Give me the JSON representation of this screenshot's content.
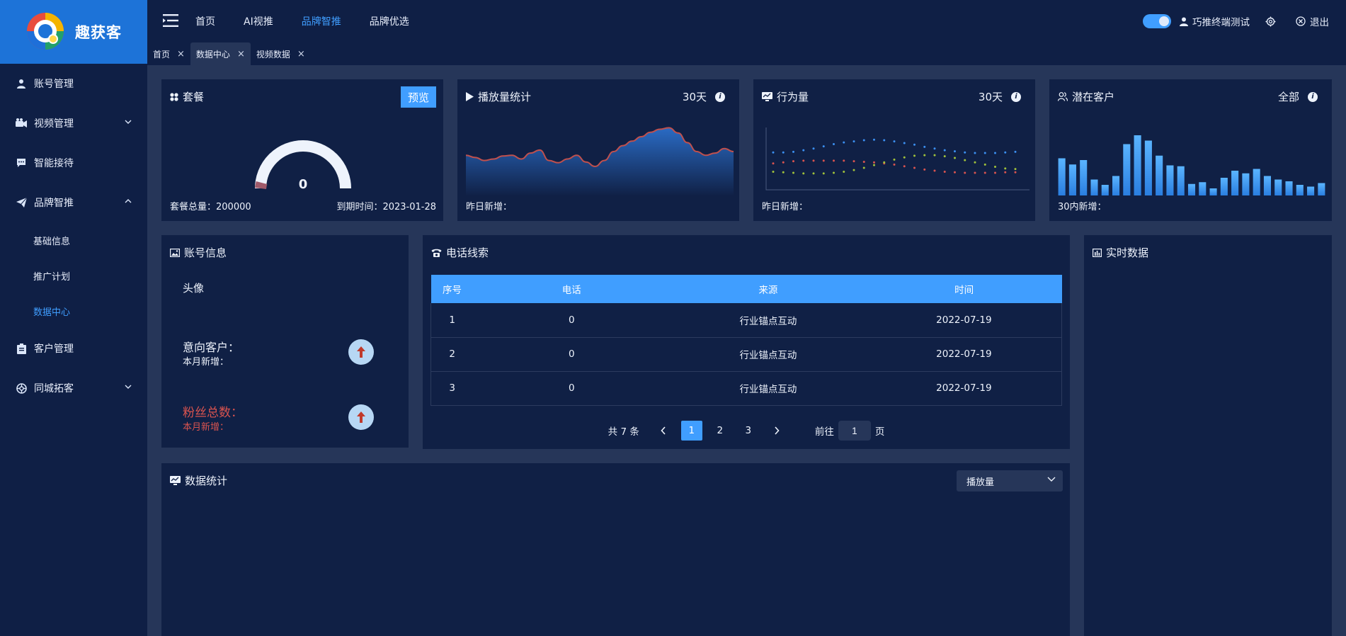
{
  "app": {
    "name": "趣获客"
  },
  "sidebar": {
    "items": [
      {
        "label": "账号管理",
        "icon": "user-icon"
      },
      {
        "label": "视频管理",
        "icon": "camera-icon"
      },
      {
        "label": "智能接待",
        "icon": "chat-icon"
      },
      {
        "label": "品牌智推",
        "icon": "paper-plane-icon"
      },
      {
        "label": "客户管理",
        "icon": "clipboard-icon"
      },
      {
        "label": "同城拓客",
        "icon": "aperture-icon"
      }
    ],
    "sub_items": [
      {
        "label": "基础信息",
        "active": false
      },
      {
        "label": "推广计划",
        "active": false
      },
      {
        "label": "数据中心",
        "active": true
      }
    ]
  },
  "topbar": {
    "nav": [
      {
        "label": "首页",
        "active": false
      },
      {
        "label": "AI视推",
        "active": false
      },
      {
        "label": "品牌智推",
        "active": true
      },
      {
        "label": "品牌优选",
        "active": false
      }
    ],
    "user_name": "巧推终端测试",
    "logout_label": "退出"
  },
  "tabs": [
    {
      "label": "首页",
      "active": false
    },
    {
      "label": "数据中心",
      "active": true
    },
    {
      "label": "视频数据",
      "active": false
    }
  ],
  "package": {
    "title": "套餐",
    "preview_label": "预览",
    "gauge_value": "0",
    "total_label": "套餐总量：200000",
    "expire_label": "到期时间：2023-01-28"
  },
  "plays": {
    "title": "播放量统计",
    "period": "30天",
    "foot": "昨日新增："
  },
  "behavior": {
    "title": "行为量",
    "period": "30天",
    "foot": "昨日新增："
  },
  "potential": {
    "title": "潜在客户",
    "period": "全部",
    "foot": "30内新增："
  },
  "account": {
    "title": "账号信息",
    "avatar_label": "头像",
    "intent_label": "意向客户：",
    "intent_sub": "本月新增：",
    "fans_label": "粉丝总数：",
    "fans_sub": "本月新增："
  },
  "leads": {
    "title": "电话线索",
    "columns": [
      "序号",
      "电话",
      "来源",
      "时间"
    ],
    "rows": [
      [
        "1",
        "0",
        "行业锚点互动",
        "2022-07-19"
      ],
      [
        "2",
        "0",
        "行业锚点互动",
        "2022-07-19"
      ],
      [
        "3",
        "0",
        "行业锚点互动",
        "2022-07-19"
      ]
    ],
    "total_label": "共 7 条",
    "pages": [
      "1",
      "2",
      "3"
    ],
    "current_page": "1",
    "goto_label": "前往",
    "goto_value": "1",
    "page_unit": "页"
  },
  "realtime": {
    "title": "实时数据"
  },
  "stats": {
    "title": "数据统计",
    "select_value": "播放量"
  },
  "colors": {
    "accent": "#409eff",
    "sidebar_bg": "#0f1f45",
    "panel_bg": "#102045",
    "page_bg": "#263659",
    "danger": "#d9534f"
  },
  "chart_data": [
    {
      "type": "area",
      "title": "",
      "x": [
        1,
        2,
        3,
        4,
        5,
        6,
        7,
        8,
        9,
        10,
        11,
        12,
        13,
        14,
        15,
        16,
        17,
        18,
        19,
        20,
        21,
        22,
        23,
        24,
        25,
        26,
        27,
        28,
        29,
        30
      ],
      "values": [
        55,
        52,
        48,
        50,
        54,
        55,
        50,
        58,
        62,
        48,
        45,
        50,
        55,
        46,
        40,
        48,
        60,
        68,
        74,
        80,
        86,
        90,
        92,
        85,
        72,
        60,
        55,
        58,
        64,
        60
      ],
      "ylim": [
        0,
        100
      ]
    },
    {
      "type": "line",
      "title": "",
      "series": [
        {
          "color": "#3b8ff0",
          "values": [
            60,
            60,
            61,
            64,
            67,
            71,
            75,
            78,
            80,
            82,
            83,
            82,
            80,
            77,
            74,
            70,
            67,
            64,
            62,
            60,
            59,
            59,
            59,
            60,
            61
          ]
        },
        {
          "color": "#d9534f",
          "values": [
            40,
            42,
            44,
            45,
            45,
            45,
            45,
            45,
            44,
            43,
            42,
            40,
            38,
            35,
            32,
            29,
            27,
            25,
            24,
            23,
            23,
            23,
            23,
            24,
            24
          ]
        },
        {
          "color": "#a0c23a",
          "values": [
            25,
            24,
            23,
            22,
            22,
            22,
            23,
            25,
            28,
            32,
            37,
            42,
            47,
            51,
            54,
            55,
            55,
            53,
            50,
            46,
            42,
            38,
            34,
            31,
            30
          ]
        }
      ],
      "ylim": [
        0,
        100
      ]
    },
    {
      "type": "bar",
      "title": "",
      "values": [
        42,
        35,
        40,
        18,
        12,
        22,
        58,
        68,
        62,
        45,
        34,
        33,
        13,
        15,
        8,
        20,
        28,
        25,
        30,
        22,
        18,
        16,
        12,
        10,
        14
      ],
      "ylim": [
        0,
        80
      ]
    }
  ]
}
